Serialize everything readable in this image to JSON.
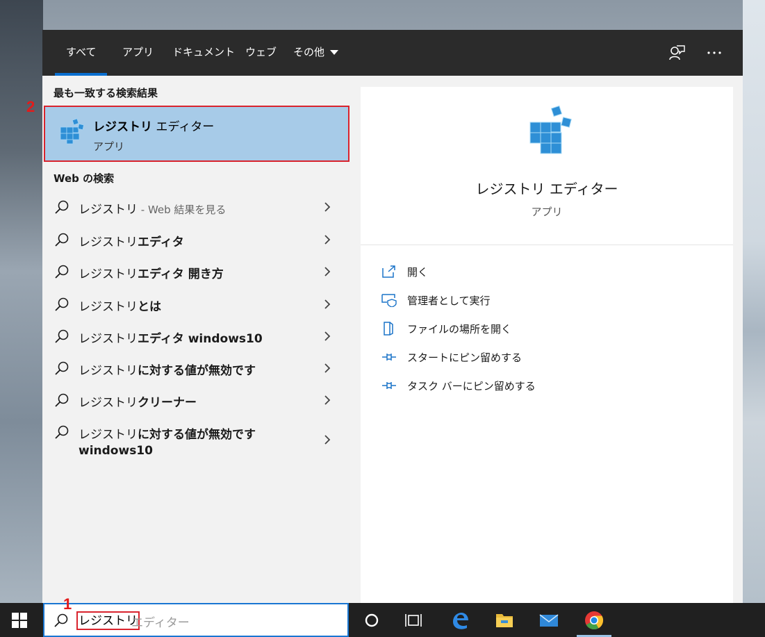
{
  "tabs": [
    {
      "label": "すべて",
      "active": true
    },
    {
      "label": "アプリ"
    },
    {
      "label": "ドキュメント"
    },
    {
      "label": "ウェブ"
    },
    {
      "label": "その他"
    }
  ],
  "best_match": {
    "heading": "最も一致する検索結果",
    "title_bold": "レジストリ",
    "title_rest": " エディター",
    "subtitle": "アプリ"
  },
  "web": {
    "heading": "Web の検索",
    "items": [
      {
        "prefix": "レジストリ",
        "bold": "",
        "sub": " - Web 結果を見る"
      },
      {
        "prefix": "レジストリ",
        "bold": "エディタ",
        "sub": ""
      },
      {
        "prefix": "レジストリ",
        "bold": "エディタ 開き方",
        "sub": ""
      },
      {
        "prefix": "レジストリ",
        "bold": "とは",
        "sub": ""
      },
      {
        "prefix": "レジストリ",
        "bold": "エディタ windows10",
        "sub": ""
      },
      {
        "prefix": "レジストリ",
        "bold": "に対する値が無効です",
        "sub": ""
      },
      {
        "prefix": "レジストリ",
        "bold": "クリーナー",
        "sub": ""
      },
      {
        "prefix": "レジストリ",
        "bold": "に対する値が無効です",
        "line2": "windows10",
        "sub": ""
      }
    ]
  },
  "detail": {
    "title": "レジストリ エディター",
    "subtitle": "アプリ",
    "actions": [
      {
        "label": "開く",
        "icon": "open-icon"
      },
      {
        "label": "管理者として実行",
        "icon": "shield-icon"
      },
      {
        "label": "ファイルの場所を開く",
        "icon": "folder-location-icon"
      },
      {
        "label": "スタートにピン留めする",
        "icon": "pin-icon"
      },
      {
        "label": "タスク バーにピン留めする",
        "icon": "pin-icon"
      }
    ]
  },
  "search": {
    "typed": "レジストリ",
    "suggestion": "エディター"
  },
  "callouts": {
    "one": "1",
    "two": "2"
  },
  "colors": {
    "accent": "#0a6fd0",
    "highlight": "#a7cbe8",
    "callout": "#d9232d"
  }
}
